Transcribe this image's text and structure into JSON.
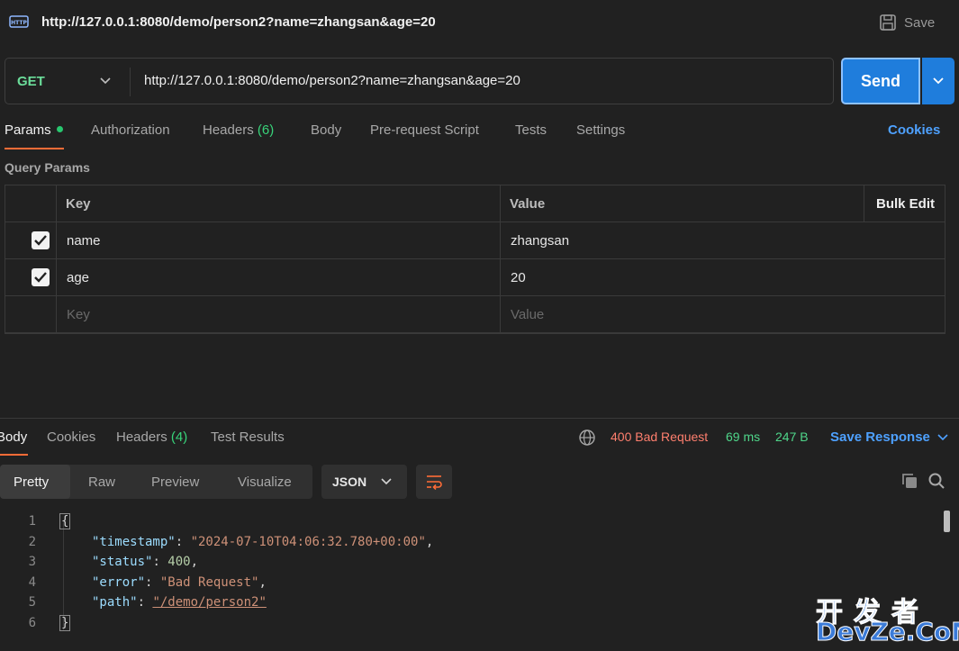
{
  "header": {
    "http_icon": "http-file-icon",
    "title": "http://127.0.0.1:8080/demo/person2?name=zhangsan&age=20",
    "save_label": "Save",
    "save_icon": "floppy-disk-icon"
  },
  "request": {
    "method": "GET",
    "url": "http://127.0.0.1:8080/demo/person2?name=zhangsan&age=20",
    "send_label": "Send"
  },
  "request_tabs": {
    "params": "Params",
    "authorization": "Authorization",
    "headers": "Headers",
    "headers_count": "(6)",
    "body": "Body",
    "pre_request": "Pre-request Script",
    "tests": "Tests",
    "settings": "Settings",
    "cookies": "Cookies"
  },
  "query_params": {
    "section_label": "Query Params",
    "columns": {
      "key": "Key",
      "value": "Value",
      "bulk_edit": "Bulk Edit"
    },
    "rows": [
      {
        "checked": true,
        "key": "name",
        "value": "zhangsan"
      },
      {
        "checked": true,
        "key": "age",
        "value": "20"
      }
    ],
    "placeholder": {
      "key": "Key",
      "value": "Value"
    }
  },
  "response_tabs": {
    "body": "Body",
    "cookies": "Cookies",
    "headers": "Headers",
    "headers_count": "(4)",
    "test_results": "Test Results"
  },
  "response_status": {
    "status": "400 Bad Request",
    "time": "69 ms",
    "size": "247 B",
    "save_response": "Save Response"
  },
  "view": {
    "pretty": "Pretty",
    "raw": "Raw",
    "preview": "Preview",
    "visualize": "Visualize",
    "format": "JSON"
  },
  "code": {
    "line_numbers": [
      "1",
      "2",
      "3",
      "4",
      "5",
      "6"
    ],
    "open_brace": "{",
    "close_brace": "}",
    "lines": [
      {
        "key": "\"timestamp\"",
        "value": "\"2024-07-10T04:06:32.780+00:00\"",
        "trail": ","
      },
      {
        "key": "\"status\"",
        "value": "400",
        "trail": ","
      },
      {
        "key": "\"error\"",
        "value": "\"Bad Request\"",
        "trail": ","
      },
      {
        "key": "\"path\"",
        "value": "\"/demo/person2\"",
        "trail": ""
      }
    ]
  },
  "watermark": {
    "cn": "开发者",
    "en": "DevZe.CoM"
  },
  "colors": {
    "accent_orange": "#ff6c37",
    "send_blue": "#1f7ddc",
    "link_blue": "#4ea1ff",
    "error_red": "#ff7f6e",
    "ok_green": "#4fd68a"
  }
}
